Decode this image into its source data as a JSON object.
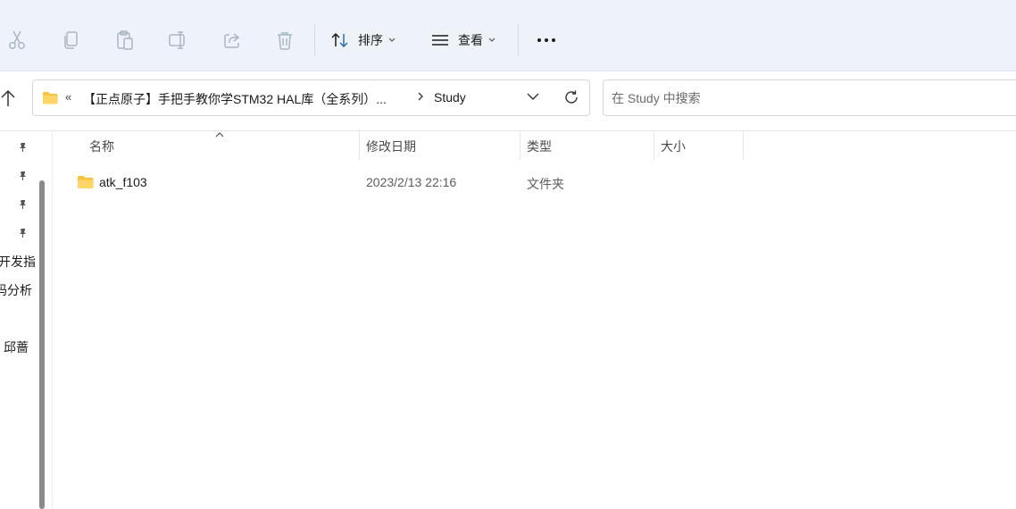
{
  "toolbar": {
    "sort_label": "排序",
    "view_label": "查看",
    "icons": [
      "cut-icon",
      "copy-icon",
      "paste-icon",
      "rename-icon",
      "share-icon",
      "delete-icon",
      "sort-icon",
      "view-icon",
      "more-icon"
    ]
  },
  "address": {
    "overflow": "«",
    "path": "【正点原子】手把手教你学STM32 HAL库（全系列）...",
    "current": "Study"
  },
  "search": {
    "placeholder": "在 Study 中搜索"
  },
  "nav": {
    "items": [
      "开发指",
      "码分析",
      "邱蔷"
    ]
  },
  "columns": {
    "name": "名称",
    "date": "修改日期",
    "type": "类型",
    "size": "大小"
  },
  "files": [
    {
      "name": "atk_f103",
      "date": "2023/2/13 22:16",
      "type": "文件夹",
      "size": ""
    }
  ],
  "colors": {
    "toolbar_bg": "#eef3f9",
    "folder_yellow": "#f5c242",
    "text": "#1a1a1a"
  }
}
